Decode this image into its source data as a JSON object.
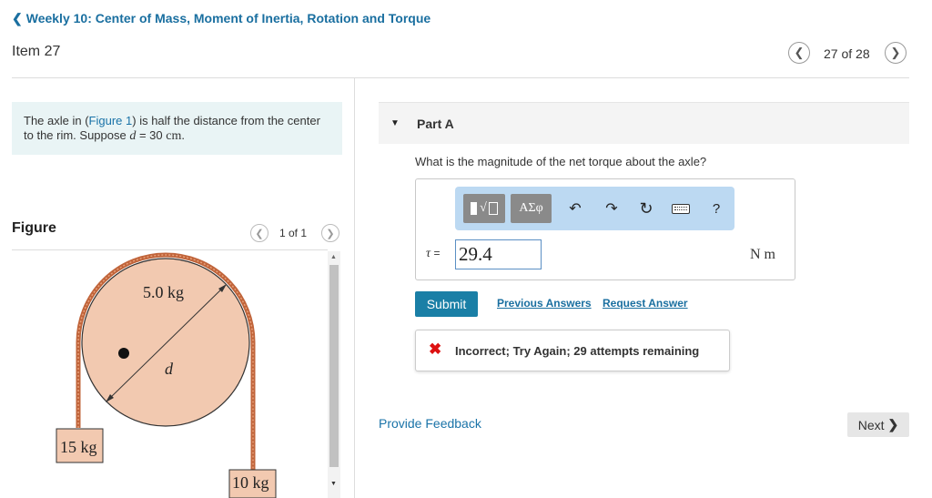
{
  "header": {
    "back_label": "Weekly 10: Center of Mass, Moment of Inertia, Rotation and Torque",
    "item_title": "Item 27",
    "counter": "27 of 28"
  },
  "problem": {
    "text_before_link": "The axle in (",
    "figure_link": "Figure 1",
    "text_after_link": ") is half the distance from the center to the rim. Suppose ",
    "var": "d",
    "equals": " = 30 ",
    "unit": "cm",
    "period": "."
  },
  "figure": {
    "label": "Figure",
    "counter": "1 of 1",
    "wheel_mass": "5.0 kg",
    "diameter_label": "d",
    "left_block": "15 kg",
    "right_block": "10 kg"
  },
  "part": {
    "label": "Part A",
    "question": "What is the magnitude of the net torque about the axle?",
    "toolbar": {
      "template_label": "√",
      "symbols_label": "ΑΣφ",
      "undo_icon": "undo-icon",
      "redo_icon": "redo-icon",
      "reset_icon": "reset-icon",
      "keyboard_icon": "keyboard-icon",
      "help_label": "?"
    },
    "var_label": "τ",
    "equals_sign": "=",
    "answer_value": "29.4",
    "unit": "N m",
    "submit_label": "Submit",
    "previous_answers": "Previous Answers",
    "request_answer": "Request Answer",
    "feedback": "Incorrect; Try Again; 29 attempts remaining"
  },
  "footer": {
    "provide_feedback": "Provide Feedback",
    "next_label": "Next"
  },
  "colors": {
    "accent": "#1a7fa6",
    "wheel_fill": "#f2c9b0",
    "rope": "#c0643a",
    "error": "#dd1111"
  }
}
